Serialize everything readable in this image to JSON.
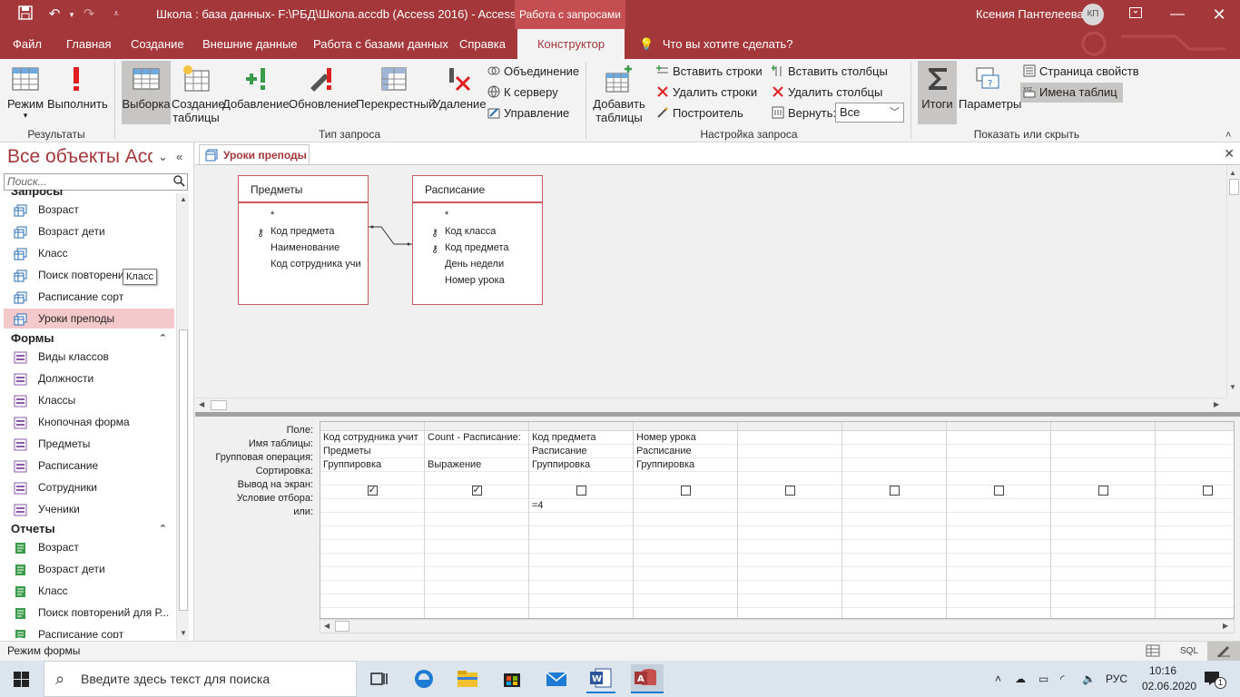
{
  "titlebar": {
    "doc_title": "Школа : база данных- F:\\РБД\\Школа.accdb (Access 2016)  -  Access",
    "context_tab": "Работа с запросами",
    "user": "Ксения Пантелеева",
    "initials": "КП"
  },
  "tabs": [
    {
      "label": "Файл"
    },
    {
      "label": "Главная"
    },
    {
      "label": "Создание"
    },
    {
      "label": "Внешние данные"
    },
    {
      "label": "Работа с базами данных"
    },
    {
      "label": "Справка"
    },
    {
      "label": "Конструктор"
    }
  ],
  "tellme": "Что вы хотите сделать?",
  "ribbon": {
    "results": {
      "view": "Режим",
      "run": "Выполнить",
      "label": "Результаты"
    },
    "query_type": {
      "select": "Выборка",
      "make_table_1": "Создание",
      "make_table_2": "таблицы",
      "append": "Добавление",
      "update": "Обновление",
      "crosstab": "Перекрестный",
      "delete": "Удаление",
      "union": "Объединение",
      "passthrough": "К серверу",
      "data_def": "Управление",
      "label": "Тип запроса"
    },
    "setup": {
      "add_tables_1": "Добавить",
      "add_tables_2": "таблицы",
      "insert_rows": "Вставить строки",
      "delete_rows": "Удалить строки",
      "builder": "Построитель",
      "insert_cols": "Вставить столбцы",
      "delete_cols": "Удалить столбцы",
      "return_label": "Вернуть:",
      "return_value": "Все",
      "label": "Настройка запроса"
    },
    "show_hide": {
      "totals": "Итоги",
      "params": "Параметры",
      "property_sheet": "Страница свойств",
      "table_names": "Имена таблиц",
      "label": "Показать или скрыть"
    }
  },
  "nav": {
    "title": "Все объекты Acc...",
    "search_placeholder": "Поиск...",
    "sections": [
      {
        "title": "Запросы",
        "items": [
          "Возраст",
          "Возраст дети",
          "Класс",
          "Поиск повторений...",
          "Расписание сорт",
          "Уроки преподы"
        ]
      },
      {
        "title": "Формы",
        "items": [
          "Виды классов",
          "Должности",
          "Классы",
          "Кнопочная форма",
          "Предметы",
          "Расписание",
          "Сотрудники",
          "Ученики"
        ]
      },
      {
        "title": "Отчеты",
        "items": [
          "Возраст",
          "Возраст дети",
          "Класс",
          "Поиск повторений для Р...",
          "Расписание сорт"
        ]
      }
    ],
    "tooltip": "Класс"
  },
  "document": {
    "tab_title": "Уроки преподы",
    "tables": [
      {
        "name": "Предметы",
        "fields": [
          {
            "name": "*",
            "key": false
          },
          {
            "name": "Код предмета",
            "key": true
          },
          {
            "name": "Наименование",
            "key": false
          },
          {
            "name": "Код сотрудника учи",
            "key": false
          }
        ]
      },
      {
        "name": "Расписание",
        "fields": [
          {
            "name": "*",
            "key": false
          },
          {
            "name": "Код класса",
            "key": true
          },
          {
            "name": "Код предмета",
            "key": true
          },
          {
            "name": "День недели",
            "key": false
          },
          {
            "name": "Номер урока",
            "key": false
          }
        ]
      }
    ],
    "grid_labels": [
      "Поле:",
      "Имя таблицы:",
      "Групповая операция:",
      "Сортировка:",
      "Вывод на экран:",
      "Условие отбора:",
      "или:"
    ],
    "grid_columns": [
      {
        "field": "Код сотрудника учит",
        "table": "Предметы",
        "group": "Группировка",
        "sort": "",
        "show": true,
        "criteria": "",
        "or": ""
      },
      {
        "field": "Count - Расписание:",
        "table": "",
        "group": "Выражение",
        "sort": "",
        "show": true,
        "criteria": "",
        "or": ""
      },
      {
        "field": "Код предмета",
        "table": "Расписание",
        "group": "Группировка",
        "sort": "",
        "show": false,
        "criteria": "=4",
        "or": ""
      },
      {
        "field": "Номер урока",
        "table": "Расписание",
        "group": "Группировка",
        "sort": "",
        "show": false,
        "criteria": "",
        "or": ""
      },
      {
        "field": "",
        "table": "",
        "group": "",
        "sort": "",
        "show": false,
        "criteria": "",
        "or": ""
      },
      {
        "field": "",
        "table": "",
        "group": "",
        "sort": "",
        "show": false,
        "criteria": "",
        "or": ""
      },
      {
        "field": "",
        "table": "",
        "group": "",
        "sort": "",
        "show": false,
        "criteria": "",
        "or": ""
      },
      {
        "field": "",
        "table": "",
        "group": "",
        "sort": "",
        "show": false,
        "criteria": "",
        "or": ""
      },
      {
        "field": "",
        "table": "",
        "group": "",
        "sort": "",
        "show": false,
        "criteria": "",
        "or": ""
      }
    ]
  },
  "statusbar": {
    "text": "Режим формы",
    "sql": "SQL"
  },
  "taskbar": {
    "search_placeholder": "Введите здесь текст для поиска",
    "lang": "РУС",
    "time": "10:16",
    "date": "02.06.2020",
    "notif": "1"
  },
  "colors": {
    "access_red": "#a4373a",
    "selected_nav": "#f4c9cc"
  }
}
